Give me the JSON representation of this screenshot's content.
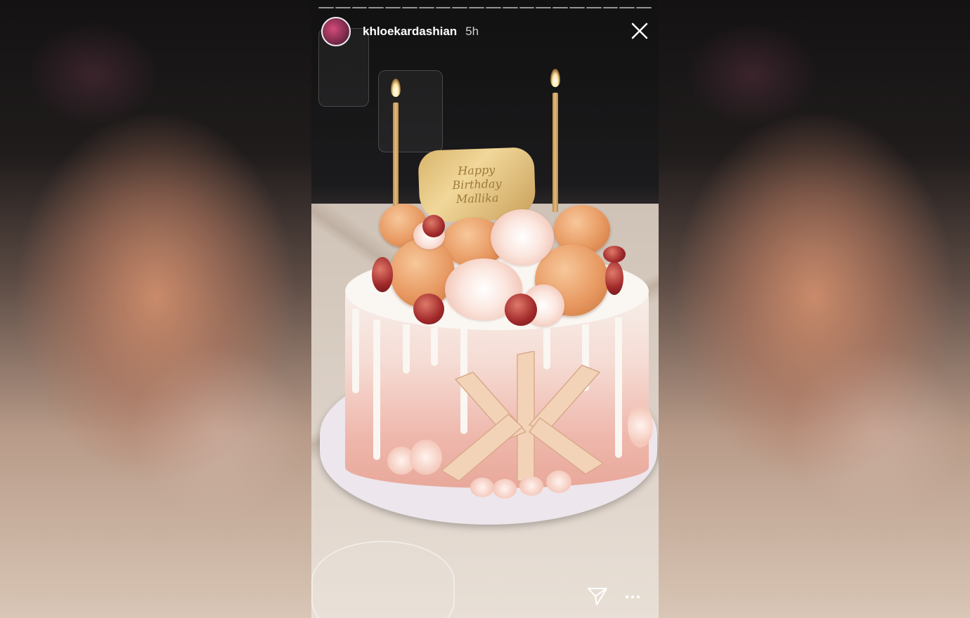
{
  "story": {
    "username": "khloekardashian",
    "time_ago": "5h",
    "progress_segments": 20
  },
  "plaque": {
    "lines": [
      "Happy",
      "Birthday",
      "Mallika"
    ]
  },
  "monogram": "K",
  "icons": {
    "close": "close-icon",
    "send": "send-icon",
    "more": "more-icon"
  },
  "colors": {
    "text": "#ffffff",
    "accent_gold": "#d8b46a",
    "cake_pink": "#efb8ad"
  }
}
